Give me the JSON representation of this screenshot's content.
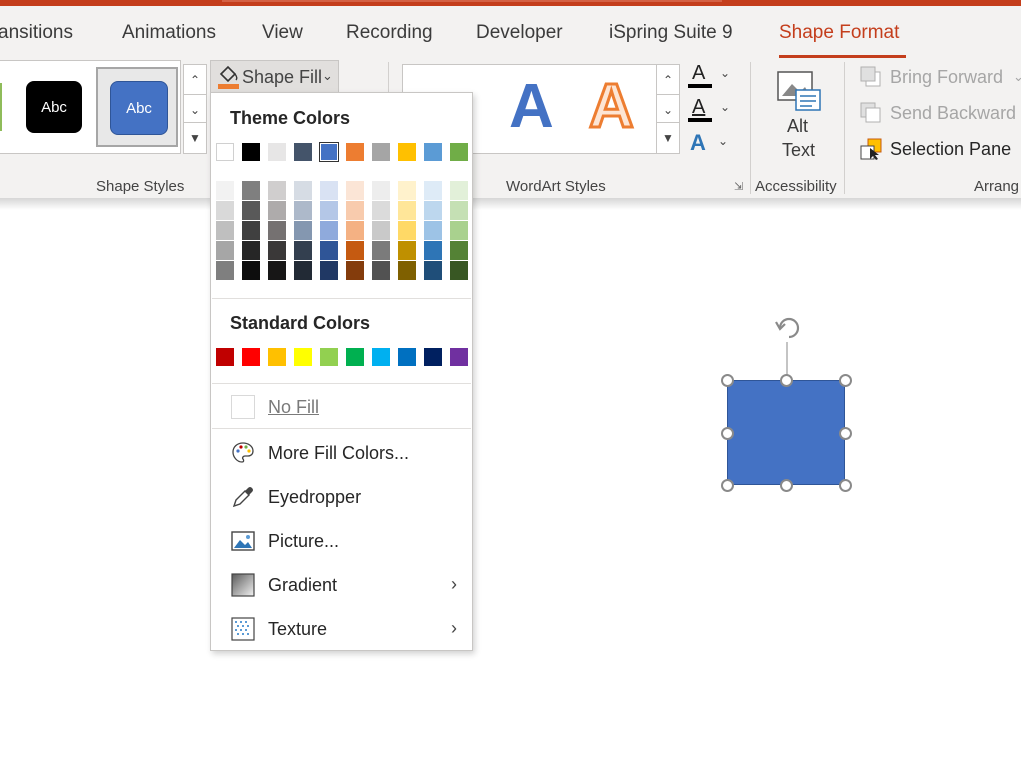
{
  "tabs": [
    "ansitions",
    "Animations",
    "View",
    "Recording",
    "Developer",
    "iSpring Suite 9",
    "Shape Format"
  ],
  "active_tab": "Shape Format",
  "shape_styles": {
    "thumb_text": [
      "Abc",
      "Abc"
    ],
    "group_label": "Shape Styles"
  },
  "shape_fill": {
    "label": "Shape Fill",
    "accent_color": "#ed7d31"
  },
  "wordart": {
    "glyphs": [
      "A",
      "A"
    ],
    "text_fill_glyph": "A",
    "text_outline_glyph": "A",
    "text_effects_glyph": "A",
    "group_label": "WordArt Styles"
  },
  "accessibility": {
    "alt_text_line1": "Alt",
    "alt_text_line2": "Text",
    "group_label": "Accessibility"
  },
  "arrange": {
    "bring_forward": "Bring Forward",
    "send_backward": "Send Backward",
    "selection_pane": "Selection Pane",
    "group_label": "Arrang"
  },
  "fill_menu": {
    "theme_heading": "Theme Colors",
    "theme_colors": [
      "#ffffff",
      "#000000",
      "#e7e6e6",
      "#44546a",
      "#4472c4",
      "#ed7d31",
      "#a5a5a5",
      "#ffc000",
      "#5b9bd5",
      "#70ad47"
    ],
    "theme_shades": [
      [
        "#f2f2f2",
        "#d9d9d9",
        "#bfbfbf",
        "#a6a6a6",
        "#7f7f7f"
      ],
      [
        "#7f7f7f",
        "#595959",
        "#404040",
        "#262626",
        "#0d0d0d"
      ],
      [
        "#d0cece",
        "#aeabab",
        "#757171",
        "#3a3838",
        "#171616"
      ],
      [
        "#d6dce4",
        "#adb9ca",
        "#8497b0",
        "#333f4f",
        "#222a35"
      ],
      [
        "#d9e2f3",
        "#b4c7e7",
        "#8faadc",
        "#2f5597",
        "#203864"
      ],
      [
        "#fbe5d6",
        "#f8cbad",
        "#f4b183",
        "#c55a11",
        "#843c0c"
      ],
      [
        "#ededed",
        "#dbdbdb",
        "#c9c9c9",
        "#7b7b7b",
        "#525252"
      ],
      [
        "#fff2cc",
        "#ffe699",
        "#ffd966",
        "#bf9000",
        "#7f6000"
      ],
      [
        "#deebf7",
        "#bdd7ee",
        "#9dc3e6",
        "#2e75b6",
        "#1f4e79"
      ],
      [
        "#e2f0d9",
        "#c5e0b4",
        "#a9d18e",
        "#548235",
        "#385723"
      ]
    ],
    "selected_theme_color": "#4472c4",
    "standard_heading": "Standard Colors",
    "standard_colors": [
      "#c00000",
      "#ff0000",
      "#ffc000",
      "#ffff00",
      "#92d050",
      "#00b050",
      "#00b0f0",
      "#0070c0",
      "#002060",
      "#7030a0"
    ],
    "no_fill": "No Fill",
    "items": [
      {
        "label": "More Fill Colors...",
        "icon": "palette-icon",
        "submenu": false
      },
      {
        "label": "Eyedropper",
        "icon": "eyedropper-icon",
        "submenu": false
      },
      {
        "label": "Picture...",
        "icon": "picture-icon",
        "submenu": false
      },
      {
        "label": "Gradient",
        "icon": "gradient-icon",
        "submenu": true
      },
      {
        "label": "Texture",
        "icon": "texture-icon",
        "submenu": true
      }
    ]
  },
  "canvas": {
    "shape_color": "#4472c4"
  }
}
